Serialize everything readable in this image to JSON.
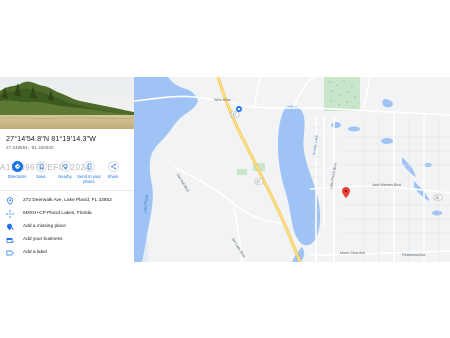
{
  "place": {
    "title": "27°14'54.8\"N 81°19'14.3\"W",
    "decimal": "27.248564, -81.320640"
  },
  "watermark": "A11409670 EFIN 2024",
  "actions": [
    {
      "label": "Directions",
      "icon": "directions-icon"
    },
    {
      "label": "Save",
      "icon": "bookmark-icon"
    },
    {
      "label": "Nearby",
      "icon": "nearby-icon"
    },
    {
      "label": "Send to your phone",
      "icon": "phone-icon"
    },
    {
      "label": "Share",
      "icon": "share-icon"
    }
  ],
  "info": {
    "address": "272 Deerwalk Ave, Lake Placid, FL 33852",
    "plus_code": "6MXH+CP Placid Lakes, Florida",
    "add_missing_place": "Add a missing place",
    "add_business": "Add your business",
    "add_label": "Add a label"
  },
  "map": {
    "poi_name": "Wiiin Dixie",
    "lake_left": "Lake Placid",
    "lake_center": "Grassy Lake",
    "road_left": "Dal Hall Blvd",
    "road_lower": "Jim Lake Blvd",
    "road_mid": "Lake Placid Blvd",
    "road_right": "Jack Warden Blvd",
    "road_bottom": "Moon Glow Ave",
    "road_bottom2": "Fleetwood Ave",
    "route_badge_1": "27",
    "route_badge_2": "27",
    "route_badge_3": "29"
  }
}
